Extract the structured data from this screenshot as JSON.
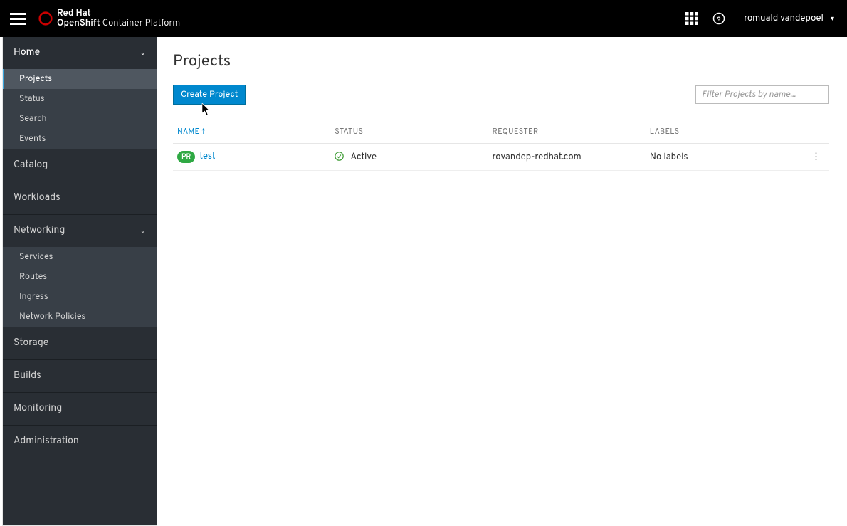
{
  "header": {
    "brand_line1": "Red Hat",
    "brand_line2_bold": "OpenShift",
    "brand_line2_rest": " Container Platform",
    "username": "romuald vandepoel"
  },
  "sidebar": {
    "sections": [
      {
        "label": "Home",
        "expanded": true,
        "items": [
          "Projects",
          "Status",
          "Search",
          "Events"
        ],
        "activeIndex": 0
      },
      {
        "label": "Catalog",
        "expanded": false
      },
      {
        "label": "Workloads",
        "expanded": false
      },
      {
        "label": "Networking",
        "expanded": true,
        "items": [
          "Services",
          "Routes",
          "Ingress",
          "Network Policies"
        ]
      },
      {
        "label": "Storage",
        "expanded": false
      },
      {
        "label": "Builds",
        "expanded": false
      },
      {
        "label": "Monitoring",
        "expanded": false
      },
      {
        "label": "Administration",
        "expanded": false
      }
    ]
  },
  "main": {
    "page_title": "Projects",
    "create_button": "Create Project",
    "filter_placeholder": "Filter Projects by name...",
    "columns": {
      "name": "NAME",
      "status": "STATUS",
      "requester": "REQUESTER",
      "labels": "LABELS"
    },
    "rows": [
      {
        "badge": "PR",
        "name": "test",
        "status": "Active",
        "requester": "rovandep-redhat.com",
        "labels": "No labels"
      }
    ]
  }
}
